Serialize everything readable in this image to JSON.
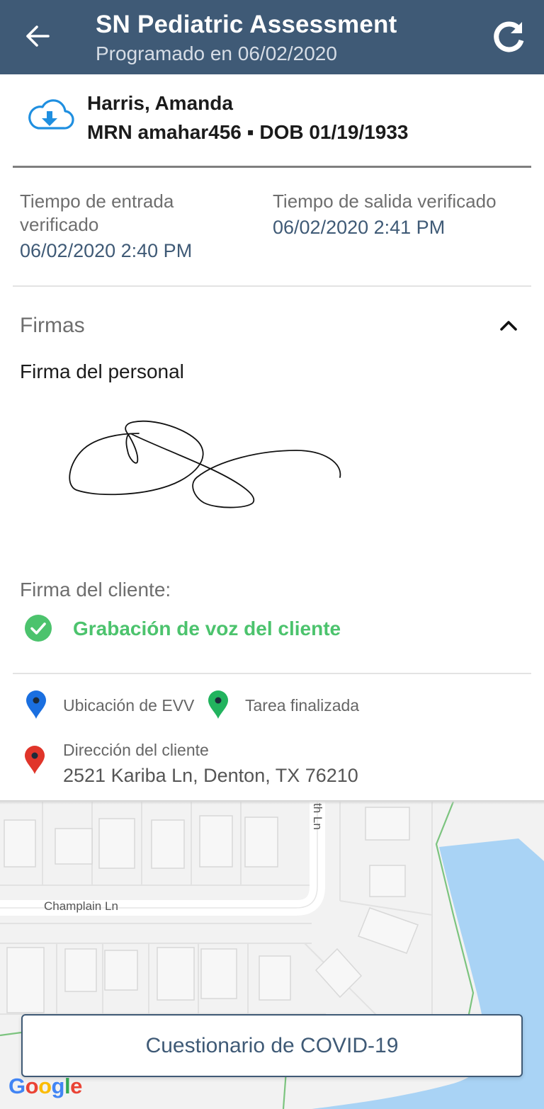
{
  "header": {
    "title": "SN Pediatric Assessment",
    "subtitle": "Programado en 06/02/2020",
    "background": "#3f5a76"
  },
  "patient": {
    "name": "Harris, Amanda",
    "ids": "MRN amahar456 ▪ DOB 01/19/1933",
    "cloud_icon_color": "#1f8fe0"
  },
  "times": {
    "check_in_label": "Tiempo de entrada verificado",
    "check_in_value": "06/02/2020 2:40 PM",
    "check_out_label": "Tiempo de salida verificado",
    "check_out_value": "06/02/2020 2:41 PM"
  },
  "signatures": {
    "section_title": "Firmas",
    "staff_label": "Firma del personal",
    "client_label": "Firma del cliente:",
    "voice_recording_label": "Grabación de voz del cliente",
    "voice_color": "#4cc36d"
  },
  "legend": {
    "evv_location": "Ubicación de EVV",
    "task_completed": "Tarea finalizada",
    "client_address_label": "Dirección del cliente",
    "client_address": "2521 Kariba Ln, Denton, TX 76210",
    "pin_colors": {
      "evv": "#1a6fe0",
      "task": "#22b35e",
      "address": "#e0352a"
    }
  },
  "map": {
    "street_champlain": "Champlain Ln",
    "street_vertical": "th Ln",
    "water_color": "#a9d3f5"
  },
  "actions": {
    "covid_button": "Cuestionario de COVID-19"
  },
  "branding": {
    "google": [
      "G",
      "o",
      "o",
      "g",
      "l",
      "e"
    ]
  }
}
